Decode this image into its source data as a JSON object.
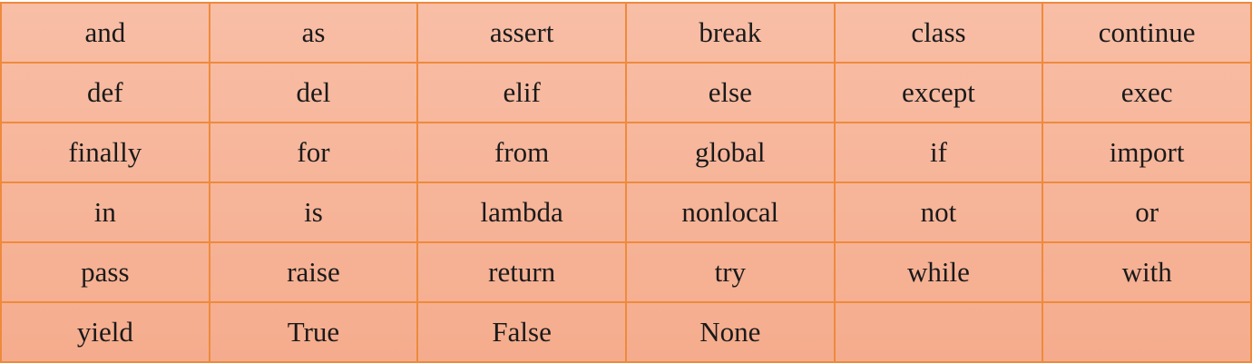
{
  "table": {
    "rows": [
      [
        "and",
        "as",
        "assert",
        "break",
        "class",
        "continue"
      ],
      [
        "def",
        "del",
        "elif",
        "else",
        "except",
        "exec"
      ],
      [
        "finally",
        "for",
        "from",
        "global",
        "if",
        "import"
      ],
      [
        "in",
        "is",
        "lambda",
        "nonlocal",
        "not",
        "or"
      ],
      [
        "pass",
        "raise",
        "return",
        "try",
        "while",
        "with"
      ],
      [
        "yield",
        "True",
        "False",
        "None",
        "",
        ""
      ]
    ]
  }
}
